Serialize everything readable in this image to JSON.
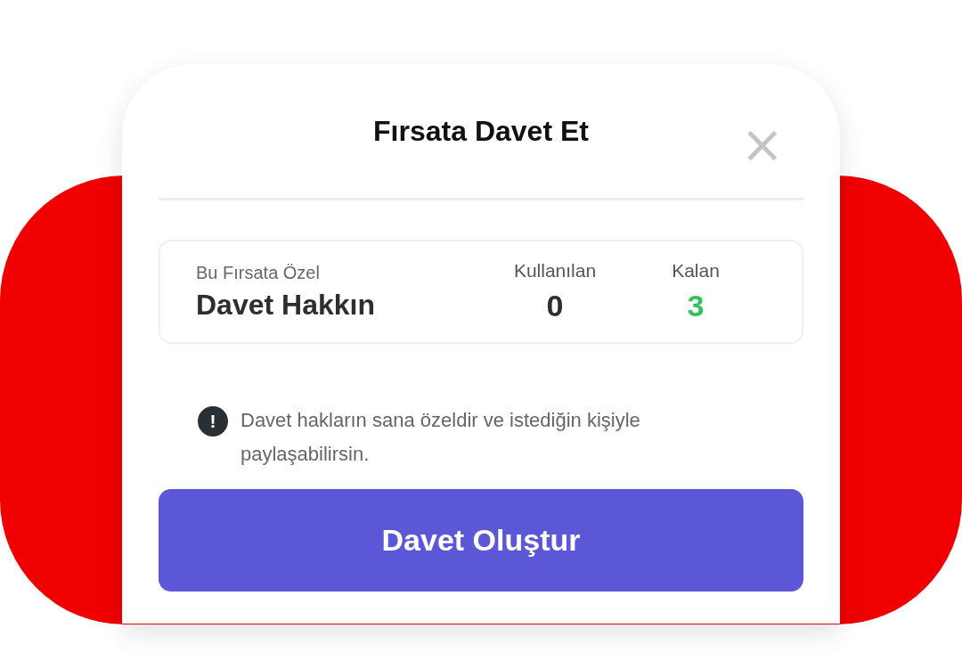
{
  "dialog": {
    "title": "Fırsata Davet Et",
    "close": "×"
  },
  "rights": {
    "caption": "Bu Fırsata Özel",
    "heading": "Davet Hakkın",
    "stats": [
      {
        "label": "Kullanılan",
        "value": "0",
        "kind": "used"
      },
      {
        "label": "Kalan",
        "value": "3",
        "kind": "remaining"
      }
    ]
  },
  "notice": {
    "icon": "!",
    "text": "Davet hakların sana özeldir ve istediğin kişiyle paylaşabilirsin."
  },
  "button": "Davet Oluştur"
}
